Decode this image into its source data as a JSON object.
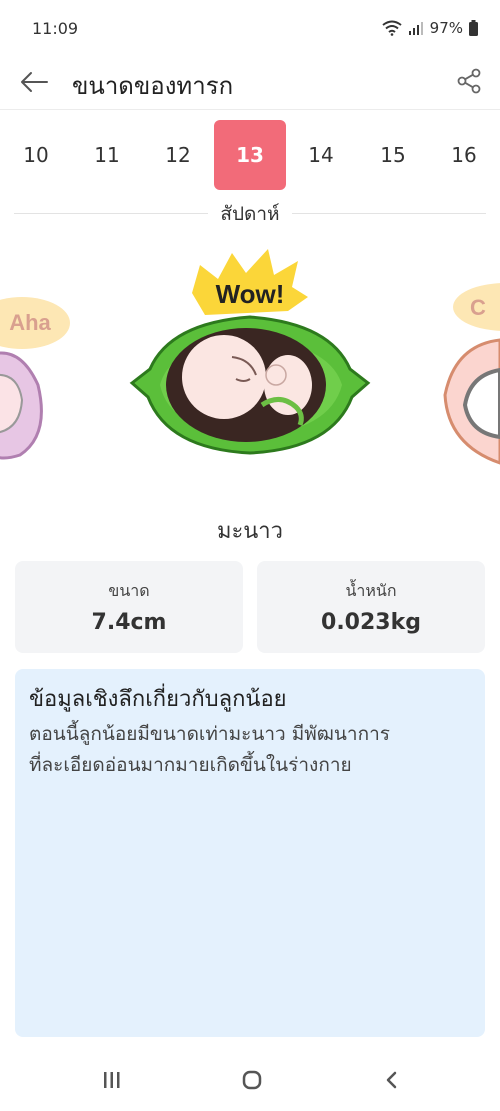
{
  "status": {
    "time": "11:09",
    "battery": "97%"
  },
  "app_bar": {
    "title": "ขนาดของทารก"
  },
  "weeks": {
    "items": [
      "10",
      "11",
      "12",
      "13",
      "14",
      "15",
      "16"
    ],
    "selected": "13",
    "label": "สัปดาห์"
  },
  "illustration": {
    "center_badge": "Wow!",
    "left_badge": "Aha",
    "right_badge": "C",
    "fruit_color": "#5bbf3a"
  },
  "fruit": {
    "name": "มะนาว"
  },
  "stats": {
    "size_label": "ขนาด",
    "size_value": "7.4cm",
    "weight_label": "น้ำหนัก",
    "weight_value": "0.023kg"
  },
  "insight": {
    "title": "ข้อมูลเชิงลึกเกี่ยวกับลูกน้อย",
    "line1": "ตอนนี้ลูกน้อยมีขนาดเท่ามะนาว มีพัฒนาการ",
    "line2": "ที่ละเอียดอ่อนมากมายเกิดขึ้นในร่างกาย"
  },
  "colors": {
    "accent": "#f26b79",
    "insight_bg": "#e4f1fd",
    "stat_bg": "#f3f4f6"
  },
  "icons": {
    "back": "arrow-left-icon",
    "share": "share-icon",
    "recents": "recents-icon",
    "home": "home-icon",
    "nav_back": "chevron-left-icon"
  }
}
